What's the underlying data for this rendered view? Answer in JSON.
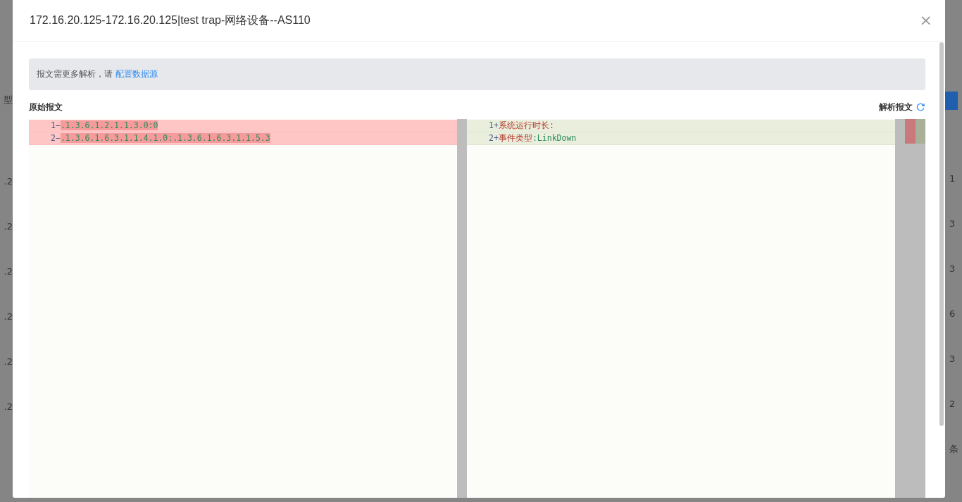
{
  "background_page": {
    "left_fragments": [
      "型",
      ".2",
      ".2",
      ".2",
      ".2",
      ".2",
      ".2"
    ],
    "right_fragments": [
      "1",
      "3",
      "3",
      "6",
      "3",
      "2",
      "条"
    ]
  },
  "dialog": {
    "title": "172.16.20.125-172.16.20.125|test trap-网络设备--AS110",
    "close": "×",
    "notice": {
      "text": "报文需更多解析，请",
      "link": "配置数据源"
    },
    "original_label": "原始报文",
    "parsed_label": "解析报文",
    "left_lines": [
      {
        "number": "1",
        "sign": "−",
        "kind": "removed",
        "parts": [
          {
            "text": ".1.3.6.1.2.1.1.3.0:0",
            "kind": "value"
          }
        ]
      },
      {
        "number": "2",
        "sign": "−",
        "kind": "removed",
        "parts": [
          {
            "text": ".1.3.6.1.6.3.1.1.4.1.0:.1.3.6.1.6.3.1.1.5.3",
            "kind": "value"
          }
        ]
      }
    ],
    "right_lines": [
      {
        "number": "1",
        "sign": "+",
        "kind": "added",
        "parts": [
          {
            "text": "系统运行时长:",
            "kind": "key"
          }
        ]
      },
      {
        "number": "2",
        "sign": "+",
        "kind": "added",
        "parts": [
          {
            "text": "事件类型",
            "kind": "key"
          },
          {
            "text": ":LinkDown",
            "kind": "value"
          }
        ]
      }
    ]
  }
}
